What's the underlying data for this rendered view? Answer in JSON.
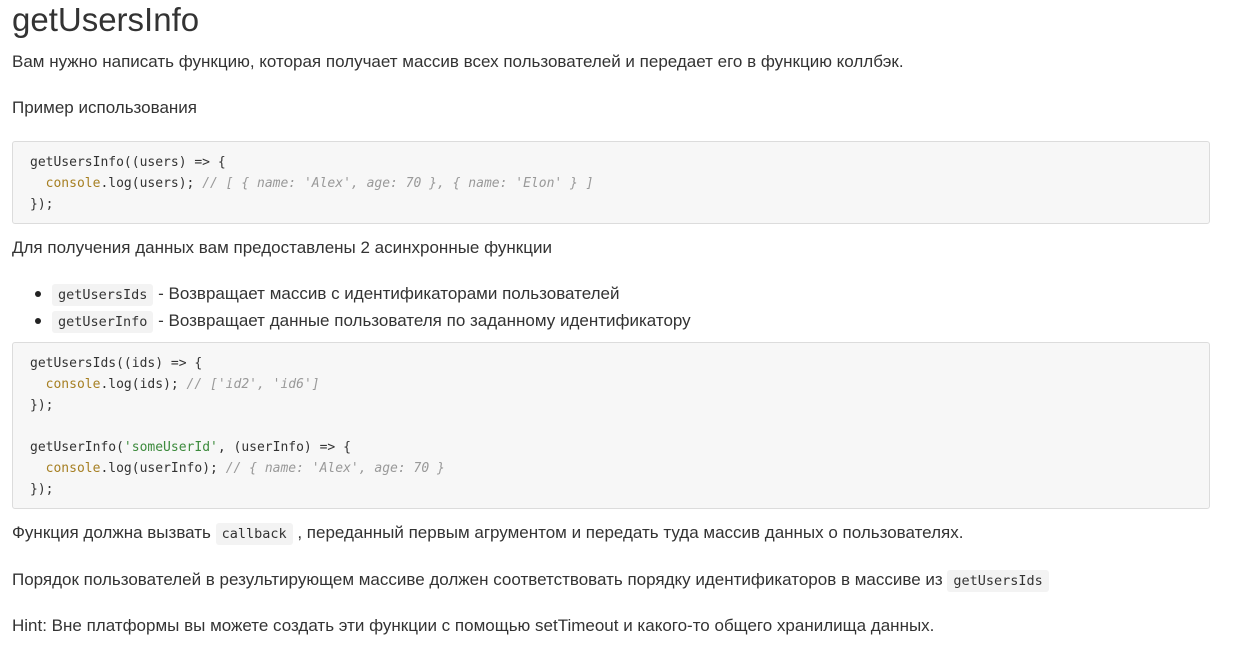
{
  "title": "getUsersInfo",
  "intro": "Вам нужно написать функцию, которая получает массив всех пользователей и передает его в функцию коллбэк.",
  "usage_heading": "Пример использования",
  "example1": {
    "line1": "getUsersInfo((users) => {",
    "line2_indent": "  ",
    "line2_console": "console",
    "line2_call": ".log(users); ",
    "line2_comment": "// [ { name: 'Alex', age: 70 }, { name: 'Elon' } ]",
    "line3": "});"
  },
  "provided_text": "Для получения данных вам предоставлены 2 асинхронные функции",
  "functions": [
    {
      "name": "getUsersIds",
      "desc": " - Возвращает массив с идентификаторами пользователей"
    },
    {
      "name": "getUserInfo",
      "desc": " - Возвращает данные пользователя по заданному идентификатору"
    }
  ],
  "example2": {
    "l1": "getUsersIds((ids) => {",
    "l2_indent": "  ",
    "l2_console": "console",
    "l2_call": ".log(ids); ",
    "l2_comment": "// ['id2', 'id6']",
    "l3": "});",
    "l5_pre": "getUserInfo(",
    "l5_str": "'someUserId'",
    "l5_post": ", (userInfo) => {",
    "l6_indent": "  ",
    "l6_console": "console",
    "l6_call": ".log(userInfo); ",
    "l6_comment": "// { name: 'Alex', age: 70 }",
    "l7": "});"
  },
  "callback_para": {
    "before": "Функция должна вызвать ",
    "code": "callback",
    "after": " , переданный первым агрументом и передать туда массив данных о пользователях."
  },
  "order_para": {
    "before": "Порядок пользователей в результирующем массиве должен соответствовать порядку идентификаторов в массиве из ",
    "code": "getUsersIds"
  },
  "hint": "Hint: Вне платформы вы можете создать эти функции с помощью setTimeout и какого-то общего хранилища данных."
}
